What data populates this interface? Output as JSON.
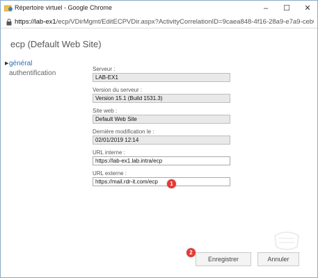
{
  "window": {
    "title": "Répertoire virtuel - Google Chrome",
    "controls": {
      "minimize": "–",
      "maximize": "☐",
      "close": "✕"
    }
  },
  "address": {
    "host": "https://lab-ex1",
    "path": "/ecp/VDirMgmt/EditECPVDir.aspx?ActivityCorrelationID=9caea848-4f16-28a9-e7a9-ceb07..."
  },
  "page": {
    "title": "ecp (Default Web Site)"
  },
  "nav": {
    "items": [
      {
        "label": "général",
        "active": true
      },
      {
        "label": "authentification",
        "active": false
      }
    ]
  },
  "form": {
    "server": {
      "label": "Serveur :",
      "value": "LAB-EX1"
    },
    "server_version": {
      "label": "Version du serveur :",
      "value": "Version 15.1 (Build 1531.3)"
    },
    "website": {
      "label": "Site web :",
      "value": "Default Web Site"
    },
    "last_modified": {
      "label": "Dernière modification le :",
      "value": "02/01/2019 12:14"
    },
    "internal_url": {
      "label": "URL interne :",
      "value": "https://lab-ex1.lab.intra/ecp"
    },
    "external_url": {
      "label": "URL externe :",
      "value": "https://mail.rdr-it.com/ecp"
    }
  },
  "annotations": {
    "badge1": "1",
    "badge2": "2"
  },
  "buttons": {
    "save": "Enregistrer",
    "cancel": "Annuler"
  },
  "colors": {
    "accent": "#2a6fb8",
    "badge": "#e53935",
    "readonly_bg": "#e9e9e9"
  }
}
